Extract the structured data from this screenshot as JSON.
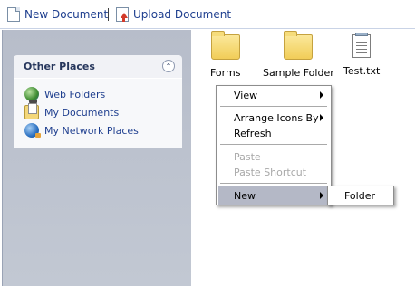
{
  "toolbar": {
    "new_document_label": "New Document",
    "separator": "|",
    "upload_document_label": "Upload Document"
  },
  "other_places": {
    "title": "Other Places",
    "collapse_symbol": "⌃",
    "items": [
      {
        "label": "Web Folders",
        "icon": "web-folders-icon"
      },
      {
        "label": "My Documents",
        "icon": "my-documents-icon"
      },
      {
        "label": "My Network Places",
        "icon": "network-places-icon"
      }
    ]
  },
  "files": [
    {
      "label": "Forms",
      "type": "folder"
    },
    {
      "label": "Sample Folder",
      "type": "folder"
    },
    {
      "label": "Test.txt",
      "type": "text-file"
    }
  ],
  "context_menu": {
    "items": {
      "view": "View",
      "arrange_icons_by": "Arrange Icons By",
      "refresh": "Refresh",
      "paste": "Paste",
      "paste_shortcut": "Paste Shortcut",
      "new": "New"
    },
    "submenu_new": {
      "folder": "Folder"
    }
  },
  "colors": {
    "link": "#1f3f8f",
    "panel_bg": "#b7bdca",
    "menu_highlight": "#b4b8c6",
    "disabled_text": "#a8a8a8"
  }
}
